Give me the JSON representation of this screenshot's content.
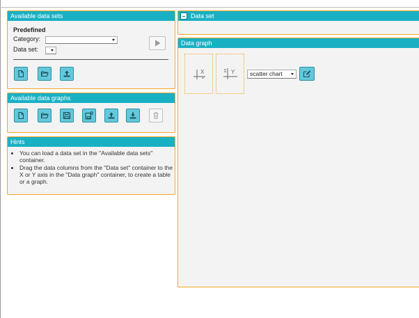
{
  "available_data_sets": {
    "title": "Available data sets",
    "predefined_label": "Predefined",
    "category_label": "Category:",
    "category_value": "",
    "dataset_label": "Data set:",
    "dataset_value": ""
  },
  "available_data_graphs": {
    "title": "Available data graphs"
  },
  "hints": {
    "title": "Hints",
    "items": [
      "You can load a data set in the \"Available data sets\" container.",
      "Drag the data columns from the \"Data set\" container to the X or Y axis in the \"Data graph\" container, to create a table or a graph."
    ]
  },
  "data_set": {
    "title": "Data set"
  },
  "data_graph": {
    "title": "Data graph",
    "x_axis_label": "X",
    "y_axis_label": "Y",
    "chart_type": "scatter chart",
    "chart_type_options": [
      "scatter chart"
    ]
  },
  "icons": {
    "new": "new-file-icon",
    "open": "open-folder-icon",
    "save": "save-icon",
    "save_as": "save-as-icon",
    "upload": "upload-icon",
    "download": "download-icon",
    "delete": "trash-icon",
    "play": "play-icon",
    "edit": "edit-icon",
    "collapse": "collapse-icon"
  },
  "colors": {
    "header": "#1ab0c4",
    "border": "#f5a623",
    "button": "#64c8dc",
    "panel_bg": "#f3f3f3"
  }
}
